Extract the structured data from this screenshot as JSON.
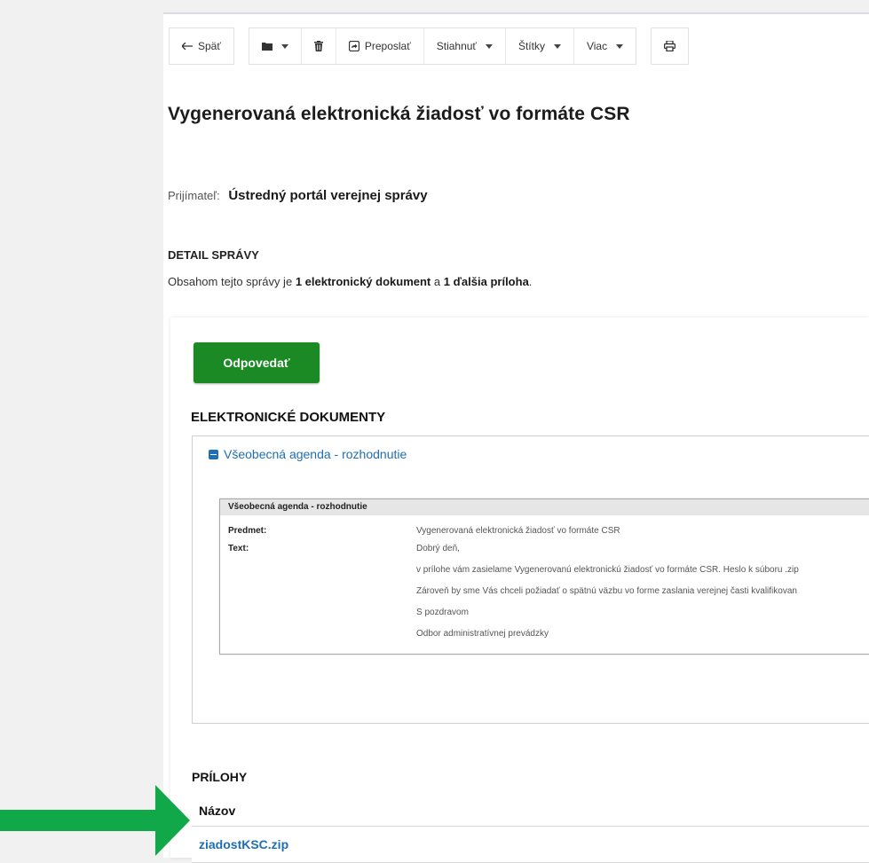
{
  "toolbar": {
    "back_label": "Späť",
    "forward_label": "Preposlať",
    "download_label": "Stiahnuť",
    "tags_label": "Štítky",
    "more_label": "Viac",
    "icons": {
      "back": "arrow-left-icon",
      "folder": "folder-icon",
      "delete": "trash-icon",
      "forward": "forward-icon",
      "print": "print-icon"
    }
  },
  "message": {
    "title": "Vygenerovaná elektronická žiadosť vo formáte CSR",
    "recipient_label": "Prijímateľ:",
    "recipient_value": "Ústredný portál verejnej správy",
    "detail_title": "DETAIL SPRÁVY",
    "detail_prefix": "Obsahom tejto správy je",
    "detail_docs": "1 elektronický dokument",
    "detail_mid": "a",
    "detail_att": "1 ďalšia príloha",
    "detail_suffix": "."
  },
  "reply_label": "Odpovedať",
  "documents": {
    "section_title": "ELEKTRONICKÉ DOKUMENTY",
    "doc_link": "Všeobecná agenda - rozhodnutie",
    "detail": {
      "header": "Všeobecná agenda - rozhodnutie",
      "subject_label": "Predmet:",
      "subject_value": "Vygenerovaná elektronická žiadosť vo formáte CSR",
      "text_label": "Text:",
      "text_lines": [
        "Dobrý deň,",
        "v prílohe vám zasielame Vygenerovanú elektronickú žiadosť vo formáte CSR. Heslo k súboru .zip",
        "Zároveň by sme Vás chceli požiadať o spätnú väzbu vo forme zaslania verejnej časti kvalifikovan",
        "S pozdravom",
        "Odbor administratívnej prevádzky"
      ]
    }
  },
  "attachments": {
    "section_title": "PRÍLOHY",
    "column_name": "Názov",
    "items": [
      {
        "name": "ziadostKSC.zip"
      }
    ]
  },
  "colors": {
    "reply_button": "#1b8a24",
    "link": "#1e6fb5",
    "arrow": "#11a84a"
  }
}
